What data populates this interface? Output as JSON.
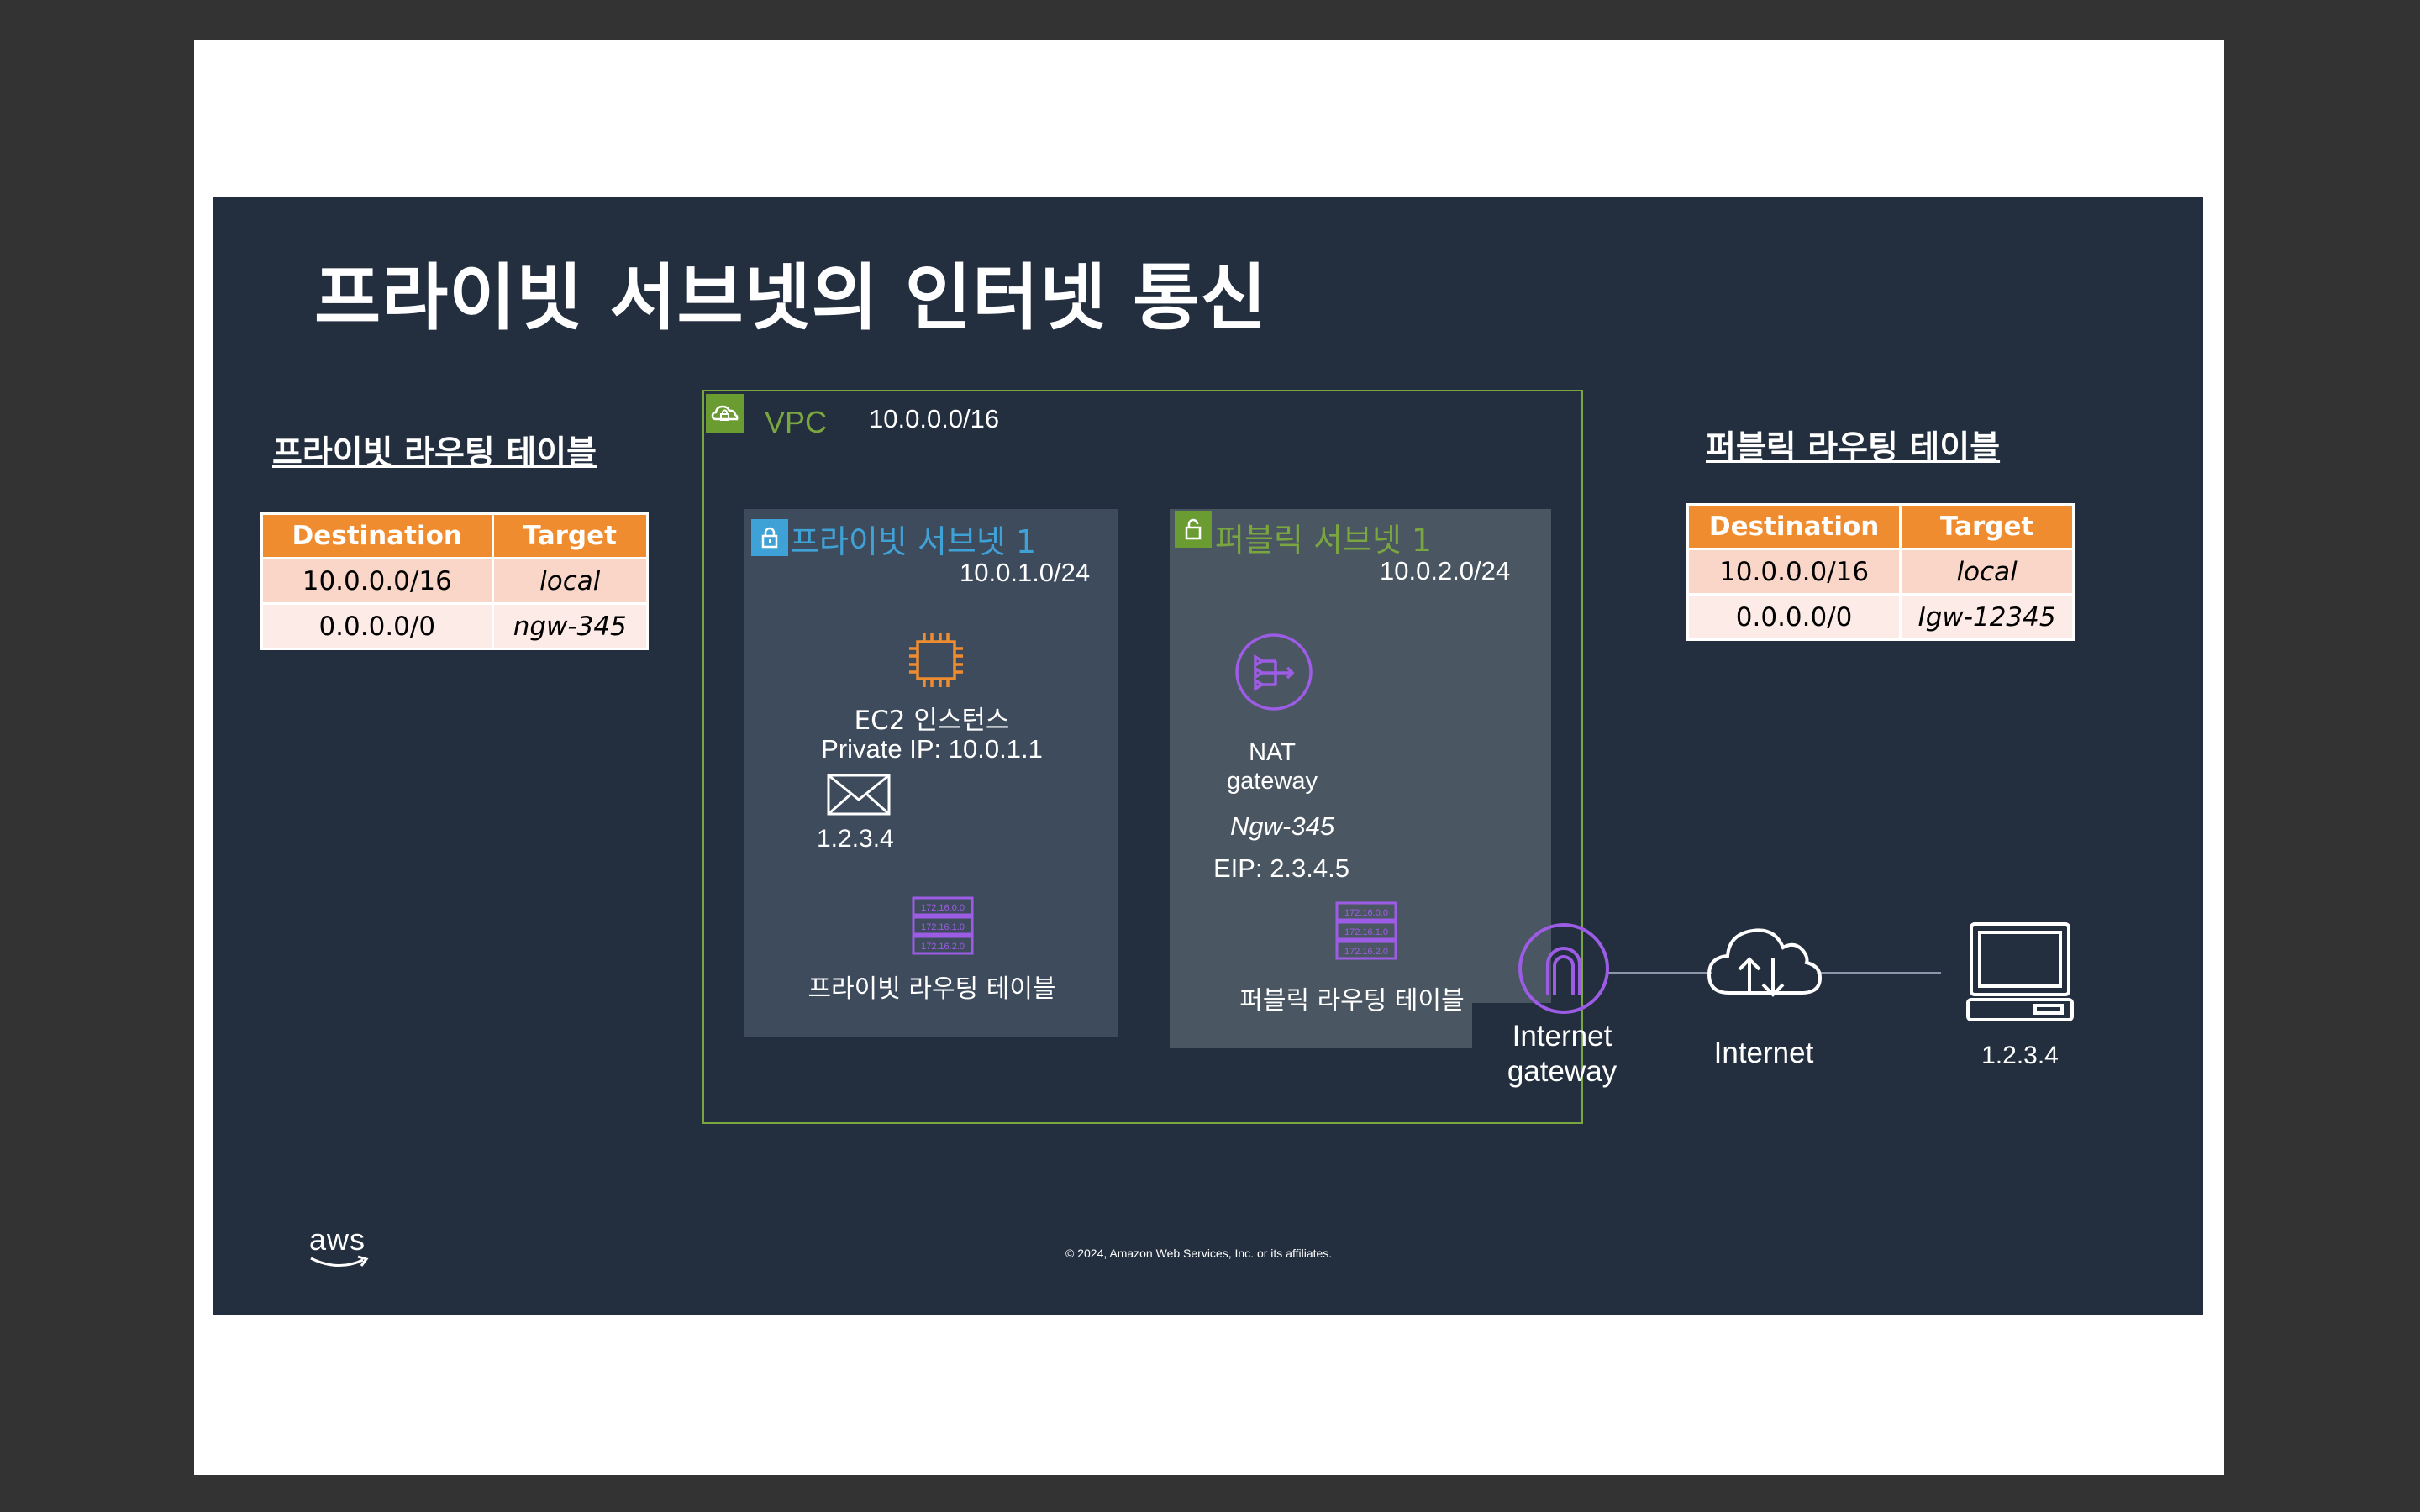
{
  "slide": {
    "title": "프라이빗 서브넷의 인터넷 통신",
    "footer": "© 2024, Amazon Web Services, Inc. or its affiliates.",
    "logo_text": "aws"
  },
  "private_route_table": {
    "title": "프라이빗 라우팅 테이블",
    "headers": [
      "Destination",
      "Target"
    ],
    "rows": [
      {
        "destination": "10.0.0.0/16",
        "target": "local"
      },
      {
        "destination": "0.0.0.0/0",
        "target": "ngw-345"
      }
    ]
  },
  "public_route_table": {
    "title": "퍼블릭 라우팅 테이블",
    "headers": [
      "Destination",
      "Target"
    ],
    "rows": [
      {
        "destination": "10.0.0.0/16",
        "target": "local"
      },
      {
        "destination": "0.0.0.0/0",
        "target": "Igw-12345"
      }
    ]
  },
  "vpc": {
    "label": "VPC",
    "cidr": "10.0.0.0/16"
  },
  "private_subnet": {
    "name": "프라이빗 서브넷 1",
    "cidr": "10.0.1.0/24",
    "ec2_label": "EC2 인스턴스",
    "private_ip": "Private IP: 10.0.1.1",
    "packet_dest": "1.2.3.4",
    "route_table_label": "프라이빗 라우팅 테이블",
    "route_table_icon_rows": [
      "172.16.0.0",
      "172.16.1.0",
      "172.16.2.0"
    ]
  },
  "public_subnet": {
    "name": "퍼블릭 서브넷 1",
    "cidr": "10.0.2.0/24",
    "nat_label_1": "NAT",
    "nat_label_2": "gateway",
    "nat_id": "Ngw-345",
    "eip": "EIP: 2.3.4.5",
    "route_table_label": "퍼블릭 라우팅 테이블",
    "route_table_icon_rows": [
      "172.16.0.0",
      "172.16.1.0",
      "172.16.2.0"
    ]
  },
  "internet_gateway": {
    "label_1": "Internet",
    "label_2": "gateway"
  },
  "internet": {
    "label": "Internet"
  },
  "client": {
    "label": "1.2.3.4"
  },
  "colors": {
    "slide_bg": "#232f3e",
    "vpc_green": "#7aa63f",
    "private_blue": "#3fa2d6",
    "public_green": "#7aa63f",
    "ec2_orange": "#f08c30",
    "network_purple": "#9d5ce6",
    "table_header": "#f08c30"
  }
}
